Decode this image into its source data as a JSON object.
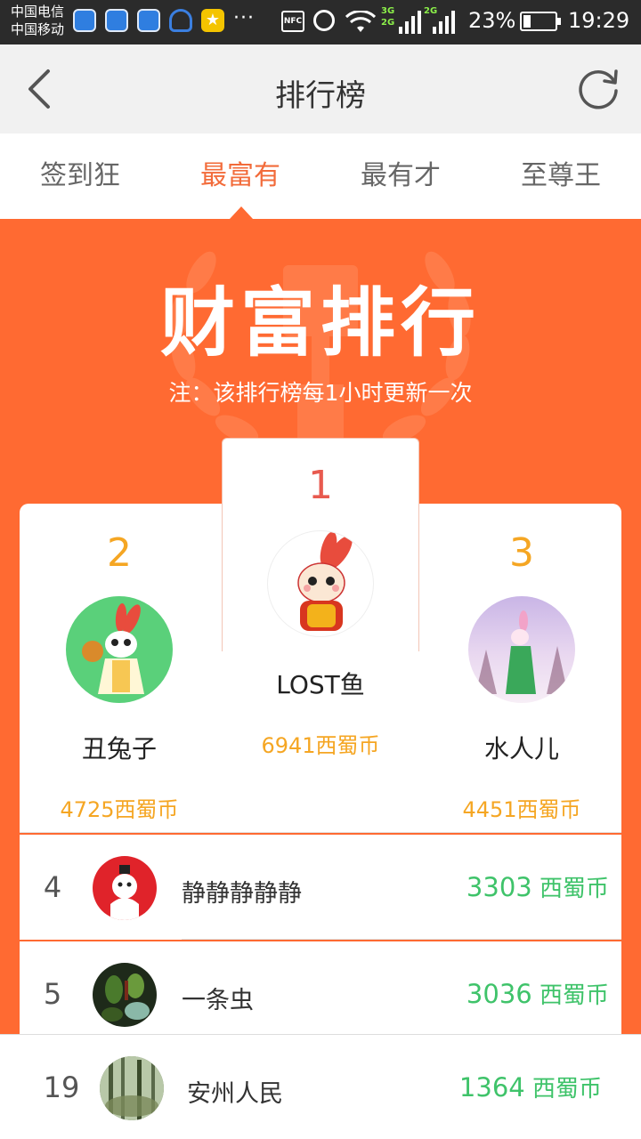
{
  "status_bar": {
    "carrier_1": "中国电信",
    "carrier_2": "中国移动",
    "dots": "···",
    "nfc": "NFC",
    "net_3g": "3G",
    "net_2g_a": "2G",
    "net_2g_b": "2G",
    "battery_percent": "23%",
    "battery_level": 0.23,
    "time": "19:29"
  },
  "nav": {
    "title": "排行榜",
    "back_icon": "chevron-left-icon",
    "refresh_icon": "refresh-icon"
  },
  "tabs": [
    {
      "label": "签到狂",
      "active": false
    },
    {
      "label": "最富有",
      "active": true
    },
    {
      "label": "最有才",
      "active": false
    },
    {
      "label": "至尊王",
      "active": false
    }
  ],
  "banner": {
    "title": "财富排行",
    "note": "注：该排行榜每1小时更新一次"
  },
  "podium": {
    "first": {
      "rank": "1",
      "name": "LOST鱼",
      "coins": "6941西蜀币"
    },
    "second": {
      "rank": "2",
      "name": "丑兔子",
      "coins": "4725西蜀币"
    },
    "third": {
      "rank": "3",
      "name": "水人儿",
      "coins": "4451西蜀币"
    }
  },
  "list": [
    {
      "rank": "4",
      "name": "静静静静静",
      "coins": "3303",
      "unit": " 西蜀币"
    },
    {
      "rank": "5",
      "name": "一条虫",
      "coins": "3036",
      "unit": " 西蜀币"
    }
  ],
  "my_rank": {
    "rank": "19",
    "name": "安州人民",
    "coins": "1364",
    "unit": " 西蜀币"
  },
  "colors": {
    "accent": "#ff6a32",
    "active_tab": "#f26b3a",
    "rank_1": "#e85a4f",
    "rank_2_3": "#f5a623",
    "coins_green": "#3fc36a"
  }
}
